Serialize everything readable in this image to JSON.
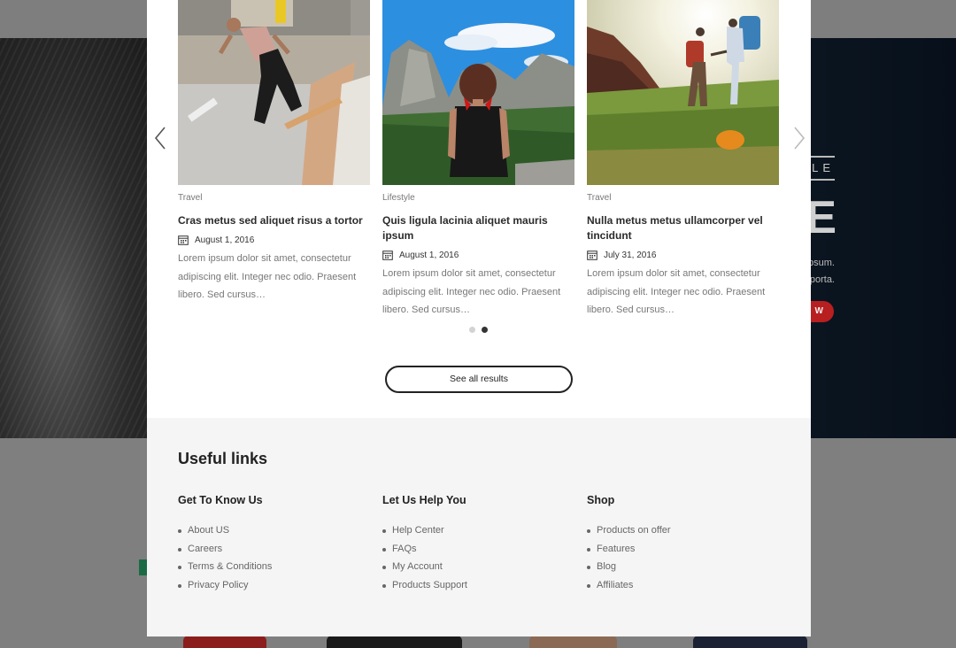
{
  "background": {
    "hero_tag": "LE",
    "hero_big_letter": "E",
    "hero_line_1": "psum.",
    "hero_line_2": "porta.",
    "hero_button": "W"
  },
  "results": [
    {
      "category": "Travel",
      "title": "Cras metus sed aliquet risus a tortor",
      "date": "August 1, 2016",
      "excerpt": "Lorem ipsum dolor sit amet, consectetur adipiscing elit. Integer nec odio. Praesent libero. Sed cursus…",
      "image": "skateboarder-photo"
    },
    {
      "category": "Lifestyle",
      "title": "Quis ligula lacinia aliquet mauris ipsum",
      "date": "August 1, 2016",
      "excerpt": "Lorem ipsum dolor sit amet, consectetur adipiscing elit. Integer nec odio. Praesent libero. Sed cursus…",
      "image": "woman-mountain-valley-photo"
    },
    {
      "category": "Travel",
      "title": "Nulla metus metus ullamcorper vel tincidunt",
      "date": "July 31, 2016",
      "excerpt": "Lorem ipsum dolor sit amet, consectetur adipiscing elit. Integer nec odio. Praesent libero. Sed cursus…",
      "image": "hikers-meadow-photo"
    }
  ],
  "carousel": {
    "pages": 2,
    "active_page": 2,
    "prev_icon": "chevron-left-icon",
    "next_icon": "chevron-right-icon"
  },
  "see_all_label": "See all results",
  "footer": {
    "heading": "Useful links",
    "columns": [
      {
        "title": "Get To Know Us",
        "links": [
          "About US",
          "Careers",
          "Terms & Conditions",
          "Privacy Policy"
        ]
      },
      {
        "title": "Let Us Help You",
        "links": [
          "Help Center",
          "FAQs",
          "My Account",
          "Products Support"
        ]
      },
      {
        "title": "Shop",
        "links": [
          "Products on offer",
          "Features",
          "Blog",
          "Affiliates"
        ]
      }
    ]
  },
  "colors": {
    "overlay": "#7f7f7f",
    "modal_bg": "#ffffff",
    "footer_bg": "#f5f5f5",
    "text_dark": "#222222",
    "text_muted": "#777777",
    "hero_button": "#b81f20"
  }
}
